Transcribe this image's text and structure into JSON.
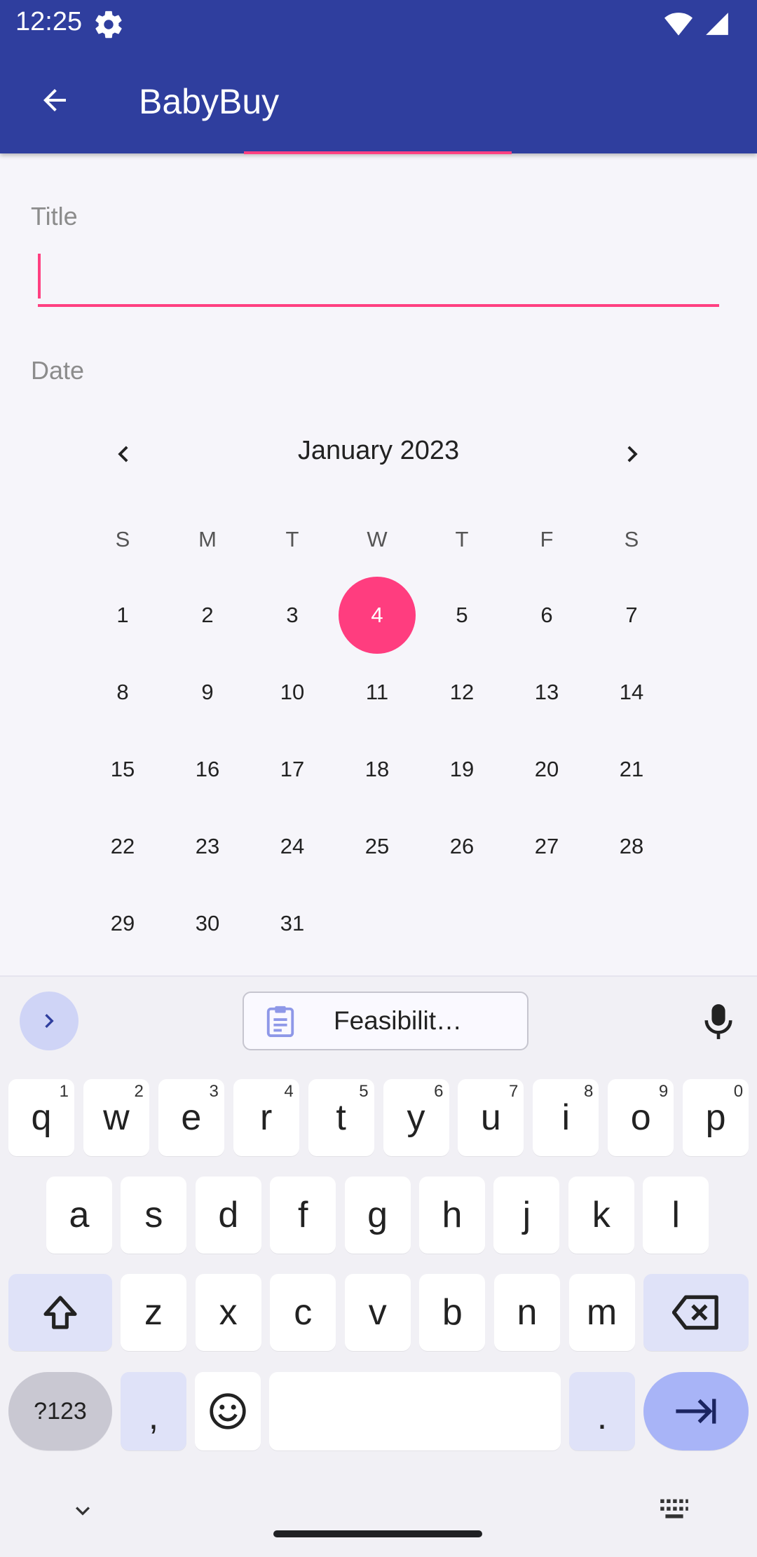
{
  "status_bar": {
    "time": "12:25",
    "icons": [
      "settings-gear-icon",
      "wifi-icon",
      "signal-icon"
    ]
  },
  "app_bar": {
    "title": "BabyBuy",
    "back_icon": "arrow-back-icon",
    "background": "#2f3e9e"
  },
  "form": {
    "title_label": "Title",
    "title_value": "",
    "date_label": "Date",
    "accent": "#ff4081"
  },
  "calendar": {
    "month_label": "January 2023",
    "prev_icon": "chevron-left-icon",
    "next_icon": "chevron-right-icon",
    "weekdays": [
      "S",
      "M",
      "T",
      "W",
      "T",
      "F",
      "S"
    ],
    "weeks": [
      [
        "1",
        "2",
        "3",
        "4",
        "5",
        "6",
        "7"
      ],
      [
        "8",
        "9",
        "10",
        "11",
        "12",
        "13",
        "14"
      ],
      [
        "15",
        "16",
        "17",
        "18",
        "19",
        "20",
        "21"
      ],
      [
        "22",
        "23",
        "24",
        "25",
        "26",
        "27",
        "28"
      ],
      [
        "29",
        "30",
        "31",
        "",
        "",
        "",
        ""
      ]
    ],
    "selected_day": "4",
    "selected_color": "#ff3d7f"
  },
  "keyboard": {
    "suggestion_chip": "Feasibilit…",
    "row1": [
      {
        "k": "q",
        "h": "1"
      },
      {
        "k": "w",
        "h": "2"
      },
      {
        "k": "e",
        "h": "3"
      },
      {
        "k": "r",
        "h": "4"
      },
      {
        "k": "t",
        "h": "5"
      },
      {
        "k": "y",
        "h": "6"
      },
      {
        "k": "u",
        "h": "7"
      },
      {
        "k": "i",
        "h": "8"
      },
      {
        "k": "o",
        "h": "9"
      },
      {
        "k": "p",
        "h": "0"
      }
    ],
    "row2": [
      "a",
      "s",
      "d",
      "f",
      "g",
      "h",
      "j",
      "k",
      "l"
    ],
    "row3": [
      "z",
      "x",
      "c",
      "v",
      "b",
      "n",
      "m"
    ],
    "symbols_key": "?123",
    "comma_key": ",",
    "period_key": ".",
    "icons": [
      "chevron-right-icon",
      "clipboard-icon",
      "mic-icon",
      "shift-icon",
      "backspace-icon",
      "emoji-icon",
      "enter-icon",
      "chevron-down-icon",
      "keyboard-icon"
    ]
  }
}
